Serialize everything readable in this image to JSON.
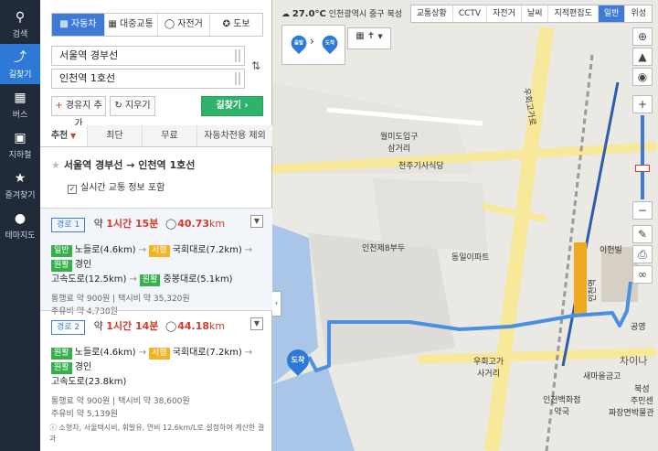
{
  "rail": [
    {
      "label": "검색",
      "icon": "search-icon"
    },
    {
      "label": "길찾기",
      "icon": "directions-icon"
    },
    {
      "label": "버스",
      "icon": "bus-icon"
    },
    {
      "label": "지하철",
      "icon": "subway-icon"
    },
    {
      "label": "즐겨찾기",
      "icon": "star-icon"
    },
    {
      "label": "테마지도",
      "icon": "pin-icon"
    }
  ],
  "modes": [
    "자동차",
    "대중교통",
    "자전거",
    "도보"
  ],
  "origin": "서울역 경부선",
  "destination": "인천역 1호선",
  "buttons": {
    "add_waypoint": "경유지 추가",
    "clear": "지우기",
    "go": "길찾기"
  },
  "tabs": [
    "추천",
    "최단",
    "무료",
    "자동차전용 제외"
  ],
  "route_title": "서울역 경부선 → 인천역 1호선",
  "realtime_label": "실시간 교통 정보 포함",
  "routes": [
    {
      "name": "경로 1",
      "time_prefix": "약",
      "time": "1시간 15분",
      "dist": "40.73",
      "dist_unit": "km",
      "path": [
        {
          "tag": "일반",
          "tag_color": "g",
          "text": "노들로(4.6km)"
        },
        {
          "tag": "서행",
          "tag_color": "y",
          "text": "국회대로(7.2km)"
        },
        {
          "tag": "원활",
          "tag_color": "g",
          "text": "경인"
        },
        {
          "tag": "",
          "tag_color": "",
          "text": "고속도로(12.5km)"
        },
        {
          "tag": "원활",
          "tag_color": "g",
          "text": "중봉대로(5.1km)"
        }
      ],
      "toll": "통행료 약 900원",
      "taxi": "택시비 약 35,320원",
      "fuel": "주유비 약 4,738원"
    },
    {
      "name": "경로 2",
      "time_prefix": "약",
      "time": "1시간 14분",
      "dist": "44.18",
      "dist_unit": "km",
      "path": [
        {
          "tag": "원활",
          "tag_color": "g",
          "text": "노들로(4.6km)"
        },
        {
          "tag": "서행",
          "tag_color": "y",
          "text": "국회대로(7.2km)"
        },
        {
          "tag": "원활",
          "tag_color": "g",
          "text": "경인"
        },
        {
          "tag": "",
          "tag_color": "",
          "text": "고속도로(23.8km)"
        }
      ],
      "toll": "통행료 약 900원",
      "taxi": "택시비 약 38,600원",
      "fuel": "주유비 약 5,139원"
    }
  ],
  "note": "ⓘ 소형차, 서울택시비, 휘발유, 연비 12.6km/L로 설정하여 계산한 결과",
  "map": {
    "weather_temp": "27.0°C",
    "weather_place": "인천광역시 중구 북성",
    "topbar": [
      "교통상황",
      "CCTV",
      "자전거",
      "날씨",
      "지적편집도",
      "일반",
      "위성"
    ],
    "legend_start": "출발",
    "legend_end": "도착",
    "labels": [
      {
        "text": "월미도입구\n삼거리"
      },
      {
        "text": "천주기사식당"
      },
      {
        "text": "인천제8부두"
      },
      {
        "text": "동일이파트"
      },
      {
        "text": "우회고가\n사거리"
      },
      {
        "text": "인천백화점\n약국"
      },
      {
        "text": "새마을금고"
      },
      {
        "text": "이헌빌"
      },
      {
        "text": "공영"
      },
      {
        "text": "차이나"
      },
      {
        "text": "북성\n주민센"
      },
      {
        "text": "짜장면박물관"
      },
      {
        "text": "우회고가로"
      },
      {
        "text": "인천역"
      },
      {
        "text": "도착"
      }
    ],
    "end_pin": "도착",
    "route_color": "#4a90e2"
  }
}
